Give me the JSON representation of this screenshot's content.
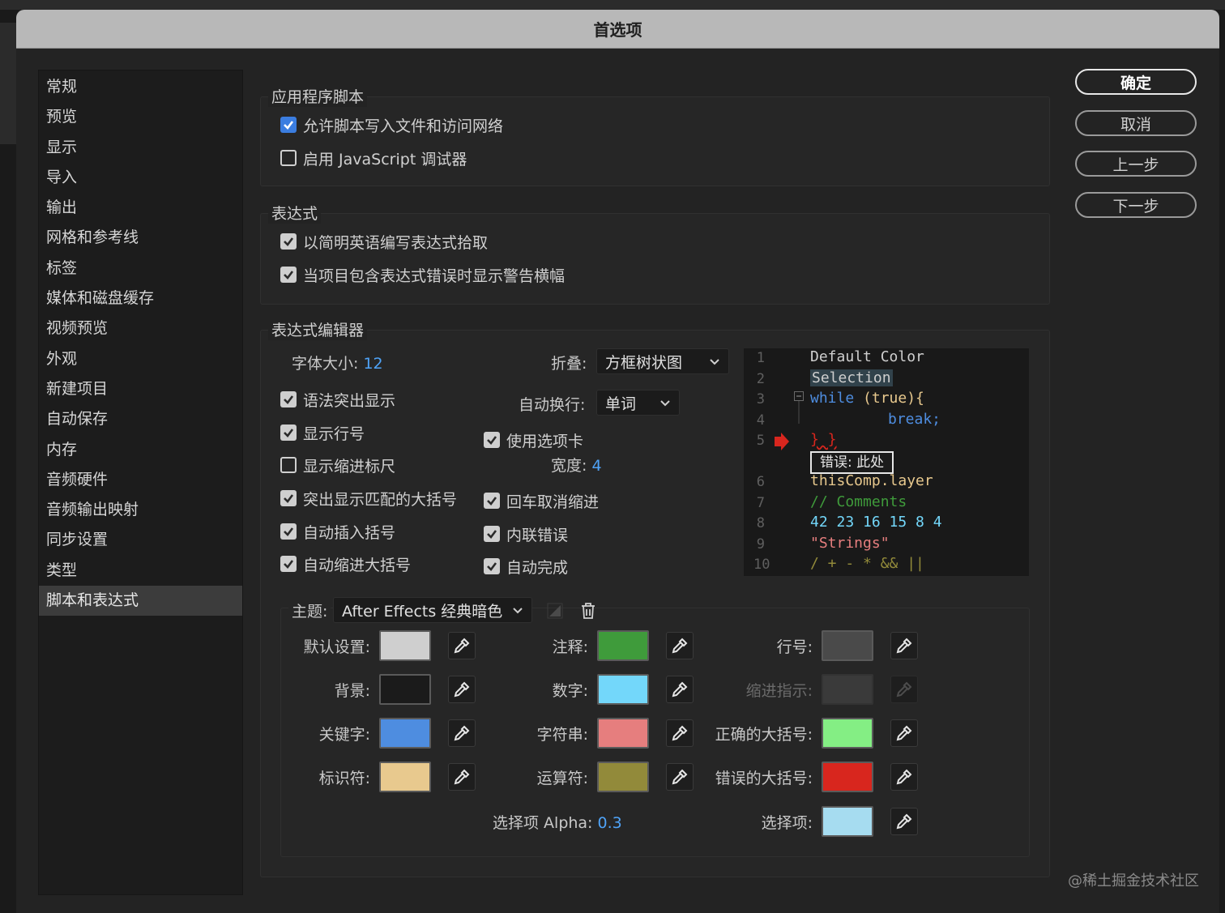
{
  "dialog": {
    "title": "首选项"
  },
  "sidebar": {
    "items": [
      "常规",
      "预览",
      "显示",
      "导入",
      "输出",
      "网格和参考线",
      "标签",
      "媒体和磁盘缓存",
      "视频预览",
      "外观",
      "新建项目",
      "自动保存",
      "内存",
      "音频硬件",
      "音频输出映射",
      "同步设置",
      "类型",
      "脚本和表达式"
    ],
    "selected": "脚本和表达式"
  },
  "buttons": {
    "ok": "确定",
    "cancel": "取消",
    "prev": "上一步",
    "next": "下一步"
  },
  "app_scripts": {
    "title": "应用程序脚本",
    "allow_write": {
      "label": "允许脚本写入文件和访问网络",
      "checked": true
    },
    "js_debugger": {
      "label": "启用 JavaScript 调试器",
      "checked": false
    }
  },
  "expressions": {
    "title": "表达式",
    "plain_english": {
      "label": "以简明英语编写表达式拾取",
      "checked": true
    },
    "warning_banner": {
      "label": "当项目包含表达式错误时显示警告横幅",
      "checked": true
    }
  },
  "editor": {
    "title": "表达式编辑器",
    "font_size_label": "字体大小:",
    "font_size_value": "12",
    "fold_label": "折叠:",
    "fold_value": "方框树状图",
    "wrap_label": "自动换行:",
    "wrap_value": "单词",
    "syntax": {
      "label": "语法突出显示",
      "checked": true
    },
    "line_numbers": {
      "label": "显示行号",
      "checked": true
    },
    "indent_ruler": {
      "label": "显示缩进标尺",
      "checked": false
    },
    "match_brackets": {
      "label": "突出显示匹配的大括号",
      "checked": true
    },
    "auto_insert": {
      "label": "自动插入括号",
      "checked": true
    },
    "auto_indent": {
      "label": "自动缩进大括号",
      "checked": true
    },
    "use_tabs": {
      "label": "使用选项卡",
      "checked": true
    },
    "tab_width_label": "宽度:",
    "tab_width_value": "4",
    "enter_unindent": {
      "label": "回车取消缩进",
      "checked": true
    },
    "inline_errors": {
      "label": "内联错误",
      "checked": true
    },
    "auto_complete": {
      "label": "自动完成",
      "checked": true
    }
  },
  "code_preview": {
    "line_numbers": [
      "1",
      "2",
      "3",
      "4",
      "5",
      "6",
      "7",
      "8",
      "9",
      "10"
    ],
    "line1": "Default Color",
    "line2": "Selection",
    "line3_kw": "while",
    "line3_rest": " (true){",
    "line4": "break;",
    "line5": "} }",
    "error_box": "错误: 此处",
    "line6": "thisComp.layer",
    "line7": "// Comments",
    "line8": "42 23 16 15 8 4",
    "line9": "\"Strings\"",
    "line10": "/ + - * && ||"
  },
  "theme": {
    "label": "主题:",
    "value": "After Effects 经典暗色",
    "colors": {
      "default": {
        "label": "默认设置:",
        "hex": "#cfcfcf"
      },
      "background": {
        "label": "背景:",
        "hex": "#1b1b1b"
      },
      "keyword": {
        "label": "关键字:",
        "hex": "#4e8de0"
      },
      "identifier": {
        "label": "标识符:",
        "hex": "#e8c98e"
      },
      "comment": {
        "label": "注释:",
        "hex": "#3f9b3b"
      },
      "number": {
        "label": "数字:",
        "hex": "#73d7fa"
      },
      "string": {
        "label": "字符串:",
        "hex": "#e67e7e"
      },
      "operator": {
        "label": "运算符:",
        "hex": "#928a3a"
      },
      "line_number": {
        "label": "行号:",
        "hex": "#4a4a4a"
      },
      "indent_guide": {
        "label": "缩进指示:",
        "hex": "#3a3a3a"
      },
      "correct_brace": {
        "label": "正确的大括号:",
        "hex": "#84ee84"
      },
      "wrong_brace": {
        "label": "错误的大括号:",
        "hex": "#d8261e"
      },
      "selection": {
        "label": "选择项:",
        "hex": "#a6dcf0"
      }
    },
    "selection_alpha_label": "选择项 Alpha:",
    "selection_alpha_value": "0.3"
  },
  "watermark": "@稀土掘金技术社区"
}
